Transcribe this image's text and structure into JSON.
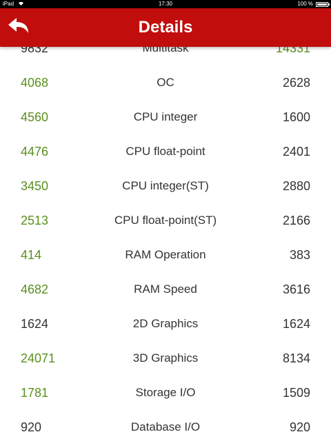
{
  "status_bar": {
    "device": "iPad",
    "wifi_icon": "wifi-icon",
    "time": "17:30",
    "battery_text": "100 %",
    "battery_level": 1.0
  },
  "nav": {
    "back_icon": "back-arrow-icon",
    "title": "Details"
  },
  "colors": {
    "nav_red": "#c20d0d",
    "green_value": "#5a8f1e",
    "text_dark": "#333333"
  },
  "rows": [
    {
      "left": "9832",
      "label": "Multitask",
      "right": "14331",
      "left_highlight": false,
      "right_highlight": true
    },
    {
      "left": "4068",
      "label": "OC",
      "right": "2628",
      "left_highlight": true,
      "right_highlight": false
    },
    {
      "left": "4560",
      "label": "CPU integer",
      "right": "1600",
      "left_highlight": true,
      "right_highlight": false
    },
    {
      "left": "4476",
      "label": "CPU float-point",
      "right": "2401",
      "left_highlight": true,
      "right_highlight": false
    },
    {
      "left": "3450",
      "label": "CPU integer(ST)",
      "right": "2880",
      "left_highlight": true,
      "right_highlight": false
    },
    {
      "left": "2513",
      "label": "CPU float-point(ST)",
      "right": "2166",
      "left_highlight": true,
      "right_highlight": false
    },
    {
      "left": "414",
      "label": "RAM Operation",
      "right": "383",
      "left_highlight": true,
      "right_highlight": false
    },
    {
      "left": "4682",
      "label": "RAM Speed",
      "right": "3616",
      "left_highlight": true,
      "right_highlight": false
    },
    {
      "left": "1624",
      "label": "2D Graphics",
      "right": "1624",
      "left_highlight": false,
      "right_highlight": false
    },
    {
      "left": "24071",
      "label": "3D Graphics",
      "right": "8134",
      "left_highlight": true,
      "right_highlight": false
    },
    {
      "left": "1781",
      "label": "Storage I/O",
      "right": "1509",
      "left_highlight": true,
      "right_highlight": false
    },
    {
      "left": "920",
      "label": "Database I/O",
      "right": "920",
      "left_highlight": false,
      "right_highlight": false
    }
  ]
}
